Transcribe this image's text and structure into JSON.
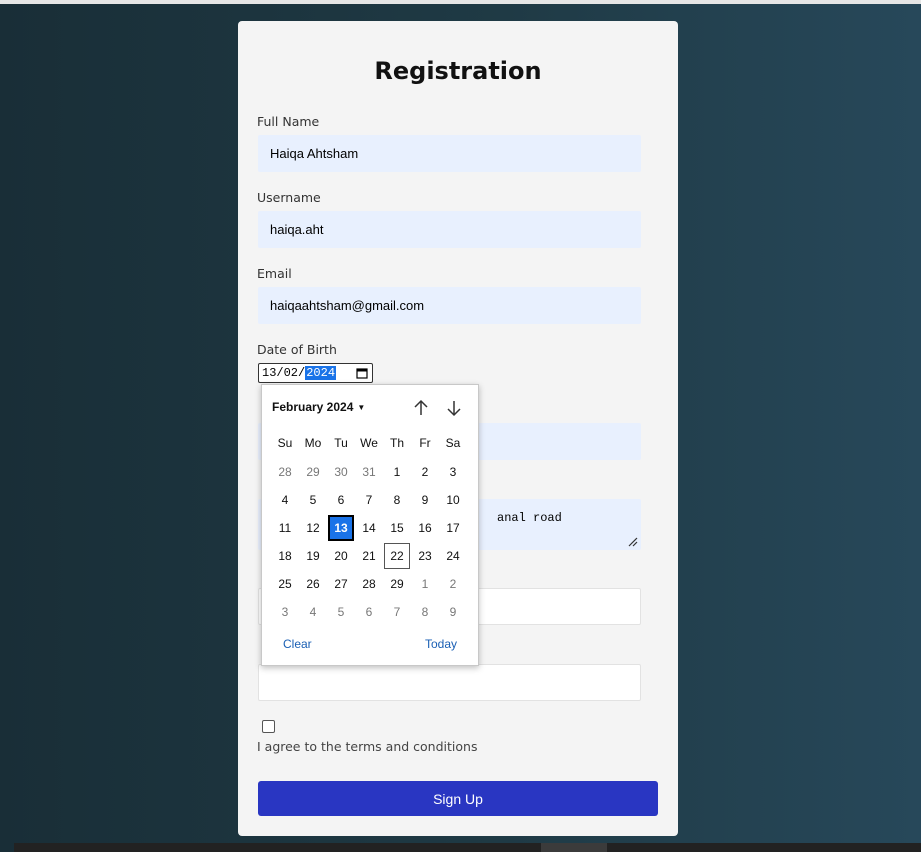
{
  "form": {
    "title": "Registration",
    "full_name": {
      "label": "Full Name",
      "value": "Haiqa Ahtsham"
    },
    "username": {
      "label": "Username",
      "value": "haiqa.aht"
    },
    "email": {
      "label": "Email",
      "value": "haiqaahtsham@gmail.com"
    },
    "dob": {
      "label": "Date of Birth",
      "day": "13",
      "month": "02",
      "year": "2024"
    },
    "address_value": "anal road",
    "terms_label": "I agree to the terms and conditions",
    "submit_label": "Sign Up"
  },
  "datepicker": {
    "month_label": "February 2024",
    "weekdays": [
      "Su",
      "Mo",
      "Tu",
      "We",
      "Th",
      "Fr",
      "Sa"
    ],
    "weeks": [
      [
        "28",
        "29",
        "30",
        "31",
        "1",
        "2",
        "3"
      ],
      [
        "4",
        "5",
        "6",
        "7",
        "8",
        "9",
        "10"
      ],
      [
        "11",
        "12",
        "13",
        "14",
        "15",
        "16",
        "17"
      ],
      [
        "18",
        "19",
        "20",
        "21",
        "22",
        "23",
        "24"
      ],
      [
        "25",
        "26",
        "27",
        "28",
        "29",
        "1",
        "2"
      ],
      [
        "3",
        "4",
        "5",
        "6",
        "7",
        "8",
        "9"
      ]
    ],
    "selected_day": "13",
    "today_day": "22",
    "clear_label": "Clear",
    "today_label": "Today"
  },
  "colors": {
    "accent": "#2936c2",
    "selected": "#1a73e8",
    "field_bg": "#e8f0fe"
  }
}
